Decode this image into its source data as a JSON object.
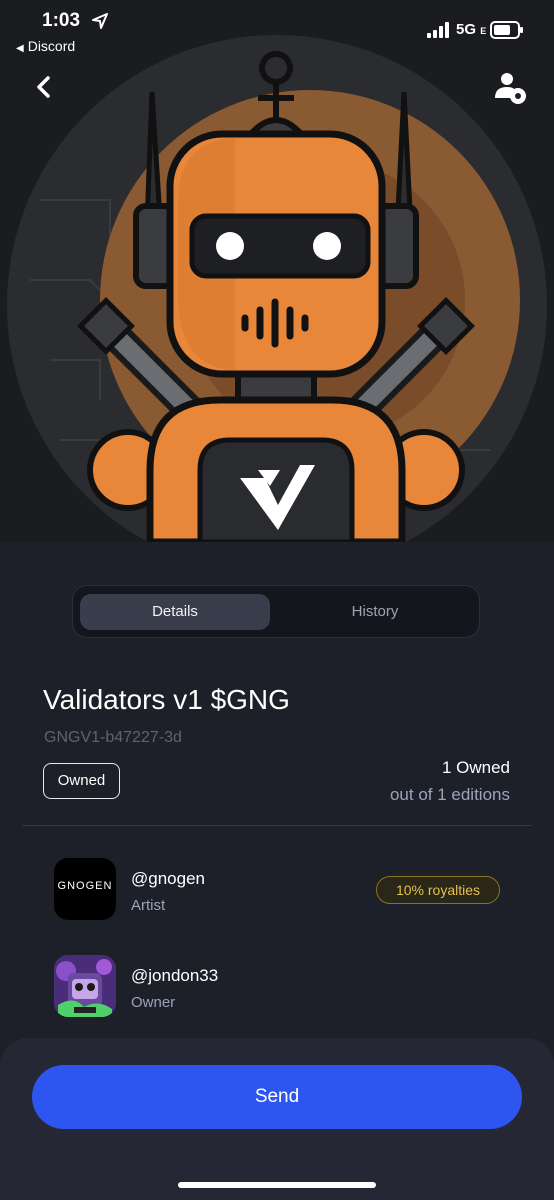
{
  "status_bar": {
    "time": "1:03",
    "back_app_label": "Discord",
    "network": "5G",
    "network_suffix": "E"
  },
  "tabs": {
    "details": "Details",
    "history": "History",
    "active": "Details"
  },
  "nft": {
    "title": "Validators v1 $GNG",
    "identifier": "GNGV1-b47227-3d",
    "owned_badge": "Owned",
    "owned_count": "1 Owned",
    "editions": "out of 1 editions"
  },
  "people": [
    {
      "handle": "@gnogen",
      "role": "Artist",
      "badge": "10% royalties",
      "avatar_logo": "GNOGEN"
    },
    {
      "handle": "@jondon33",
      "role": "Owner"
    }
  ],
  "actions": {
    "send": "Send"
  },
  "colors": {
    "background": "#1d2029",
    "accent": "#2d56f0",
    "robot_orange": "#e8873a",
    "royalty_gold": "#e3c04a"
  }
}
